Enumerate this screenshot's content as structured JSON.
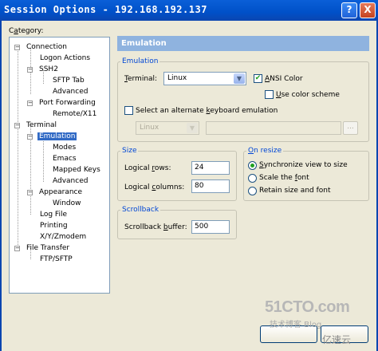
{
  "window": {
    "title": "Session Options - 192.168.192.137",
    "help_glyph": "?",
    "close_glyph": "X"
  },
  "category": {
    "label_before": "C",
    "label_under": "a",
    "label_after": "tegory:",
    "tree": [
      {
        "label": "Connection",
        "expander": "−"
      },
      {
        "label": "Logon Actions"
      },
      {
        "label": "SSH2",
        "expander": "−"
      },
      {
        "label": "SFTP Tab"
      },
      {
        "label": "Advanced"
      },
      {
        "label": "Port Forwarding",
        "expander": "−"
      },
      {
        "label": "Remote/X11"
      },
      {
        "label": "Terminal",
        "expander": "−"
      },
      {
        "label": "Emulation",
        "expander": "−",
        "selected": true
      },
      {
        "label": "Modes"
      },
      {
        "label": "Emacs"
      },
      {
        "label": "Mapped Keys"
      },
      {
        "label": "Advanced"
      },
      {
        "label": "Appearance",
        "expander": "−"
      },
      {
        "label": "Window"
      },
      {
        "label": "Log File"
      },
      {
        "label": "Printing"
      },
      {
        "label": "X/Y/Zmodem"
      },
      {
        "label": "File Transfer",
        "expander": "−"
      },
      {
        "label": "FTP/SFTP"
      }
    ]
  },
  "panel": {
    "header": "Emulation",
    "emulation_group": {
      "legend": "Emulation",
      "terminal_label_before": "",
      "terminal_label_under": "T",
      "terminal_label_after": "erminal:",
      "terminal_value": "Linux",
      "ansi_color_before": "",
      "ansi_color_under": "A",
      "ansi_color_after": "NSI Color",
      "ansi_color_checked": true,
      "use_color_scheme_before": "",
      "use_color_scheme_under": "U",
      "use_color_scheme_after": "se color scheme",
      "use_color_scheme_checked": false,
      "alt_keyboard_before": "Select an alternate ",
      "alt_keyboard_under": "k",
      "alt_keyboard_after": "eyboard emulation",
      "alt_keyboard_checked": false,
      "alt_keyboard_value": "Linux",
      "browse_label": "..."
    },
    "size_group": {
      "legend": "Size",
      "logical_rows_before": "Logical ",
      "logical_rows_under": "r",
      "logical_rows_after": "ows:",
      "logical_rows_value": "24",
      "logical_columns_before": "Logical ",
      "logical_columns_under": "c",
      "logical_columns_after": "olumns:",
      "logical_columns_value": "80"
    },
    "resize_group": {
      "legend_before": "",
      "legend_under": "O",
      "legend_after": "n resize",
      "sync_before": "",
      "sync_under": "S",
      "sync_after": "ynchronize view to size",
      "scale_before": "Scale the ",
      "scale_under": "f",
      "scale_after": "ont",
      "retain_before": "Retain size and font",
      "selected": "sync"
    },
    "scrollback_group": {
      "legend": "Scrollback",
      "buffer_before": "Scrollback ",
      "buffer_under": "b",
      "buffer_after": "uffer:",
      "buffer_value": "500"
    }
  },
  "watermark": {
    "site": "51CTO.com",
    "tagline": "技术博客  Blog",
    "logo": "亿速云"
  },
  "colors": {
    "titlebar": "#0050c8",
    "panel_header": "#8fb3df",
    "selection": "#316ac5",
    "group_legend": "#0046d5"
  }
}
